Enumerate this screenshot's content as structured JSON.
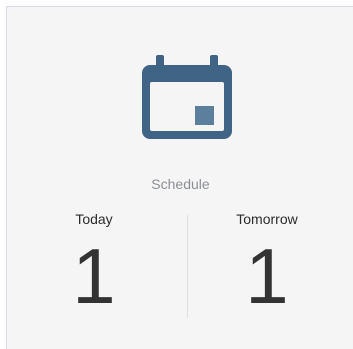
{
  "widget": {
    "icon": "calendar-icon",
    "label": "Schedule",
    "columns": [
      {
        "title": "Today",
        "count": "1"
      },
      {
        "title": "Tomorrow",
        "count": "1"
      }
    ],
    "colors": {
      "icon": "#3f6486",
      "label": "#8b8f94",
      "background": "#f5f5f6"
    }
  }
}
